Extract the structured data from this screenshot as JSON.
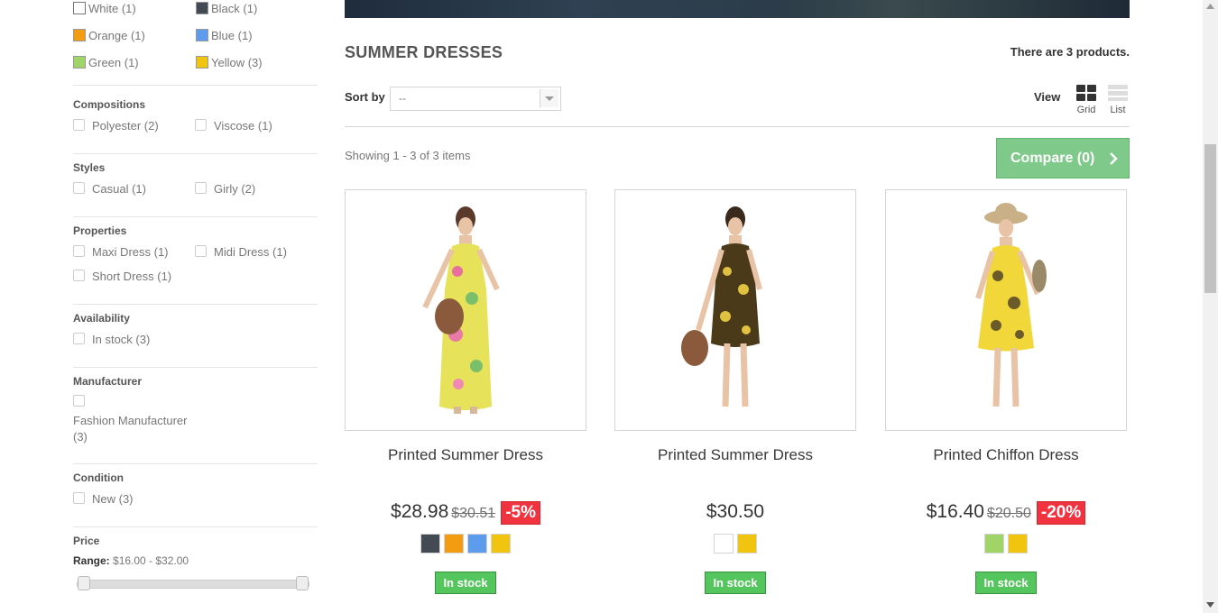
{
  "colors": [
    {
      "label": "White (1)",
      "hex": "#ffffff"
    },
    {
      "label": "Black (1)",
      "hex": "#434a54"
    },
    {
      "label": "Orange (1)",
      "hex": "#f39c11"
    },
    {
      "label": "Blue (1)",
      "hex": "#5d9cec"
    },
    {
      "label": "Green (1)",
      "hex": "#a0d468"
    },
    {
      "label": "Yellow (3)",
      "hex": "#f1c40f"
    }
  ],
  "filters": {
    "compositions": {
      "title": "Compositions",
      "items": [
        "Polyester (2)",
        "Viscose (1)"
      ]
    },
    "styles": {
      "title": "Styles",
      "items": [
        "Casual (1)",
        "Girly (2)"
      ]
    },
    "properties": {
      "title": "Properties",
      "items": [
        "Maxi Dress (1)",
        "Midi Dress (1)",
        "Short Dress (1)"
      ]
    },
    "availability": {
      "title": "Availability",
      "items": [
        "In stock (3)"
      ]
    },
    "manufacturer": {
      "title": "Manufacturer",
      "items": [
        "Fashion Manufacturer",
        "(3)"
      ]
    },
    "condition": {
      "title": "Condition",
      "items": [
        "New (3)"
      ]
    },
    "price": {
      "title": "Price",
      "range_label": "Range:",
      "range_value": "$16.00 - $32.00",
      "min": 16,
      "max": 32,
      "selected_min": 16,
      "selected_max": 32
    }
  },
  "main": {
    "category_title": "SUMMER DRESSES",
    "product_count": "There are 3 products.",
    "sort_label": "Sort by",
    "sort_value": "--",
    "view_label": "View",
    "grid_label": "Grid",
    "list_label": "List",
    "showing": "Showing 1 - 3 of 3 items",
    "compare": "Compare (0)"
  },
  "products": [
    {
      "name": "Printed Summer Dress",
      "price": "$28.98",
      "old_price": "$30.51",
      "discount": "-5%",
      "swatches": [
        "#434a54",
        "#f39c11",
        "#5d9cec",
        "#f1c40f"
      ],
      "stock": "In stock"
    },
    {
      "name": "Printed Summer Dress",
      "price": "$30.50",
      "old_price": "",
      "discount": "",
      "swatches": [
        "#ffffff",
        "#f1c40f"
      ],
      "stock": "In stock"
    },
    {
      "name": "Printed Chiffon Dress",
      "price": "$16.40",
      "old_price": "$20.50",
      "discount": "-20%",
      "swatches": [
        "#a0d468",
        "#f1c40f"
      ],
      "stock": "In stock"
    }
  ]
}
